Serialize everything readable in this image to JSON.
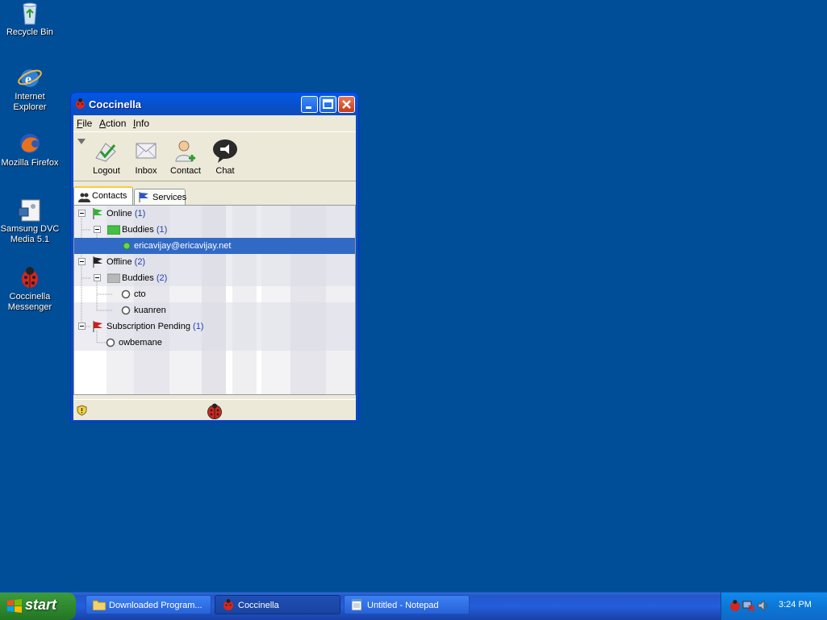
{
  "desktop": {
    "icons": [
      {
        "label": "Recycle Bin",
        "icon": "recycle-bin-icon"
      },
      {
        "label": "Internet Explorer",
        "icon": "internet-explorer-icon"
      },
      {
        "label": "Mozilla Firefox",
        "icon": "firefox-icon"
      },
      {
        "label": "Samsung DVC Media 5.1",
        "icon": "samsung-dvc-icon"
      },
      {
        "label": "Coccinella Messenger",
        "icon": "ladybug-icon"
      }
    ]
  },
  "window": {
    "title": "Coccinella",
    "menu": [
      "File",
      "Action",
      "Info"
    ],
    "toolbar": [
      {
        "label": "Logout",
        "icon": "logout-icon"
      },
      {
        "label": "Inbox",
        "icon": "inbox-icon"
      },
      {
        "label": "Contact",
        "icon": "add-contact-icon"
      },
      {
        "label": "Chat",
        "icon": "chat-icon"
      }
    ],
    "tabs": [
      {
        "label": "Contacts",
        "icon": "contacts-icon",
        "active": true
      },
      {
        "label": "Services",
        "icon": "flag-icon",
        "active": false
      }
    ],
    "tree": {
      "online": {
        "label": "Online",
        "count": "(1)"
      },
      "online_buddies": {
        "label": "Buddies",
        "count": "(1)"
      },
      "online_contact": "ericavijay@ericavijay.net",
      "offline": {
        "label": "Offline",
        "count": "(2)"
      },
      "offline_buddies": {
        "label": "Buddies",
        "count": "(2)"
      },
      "offline_contacts": [
        "cto",
        "kuanren"
      ],
      "pending": {
        "label": "Subscription Pending",
        "count": "(1)"
      },
      "pending_contact": "owbemane"
    }
  },
  "taskbar": {
    "start_label": "start",
    "tasks": [
      {
        "label": "Downloaded Program...",
        "icon": "folder-icon",
        "active": false
      },
      {
        "label": "Coccinella",
        "icon": "ladybug-icon",
        "active": true
      },
      {
        "label": "Untitled - Notepad",
        "icon": "notepad-icon",
        "active": false
      }
    ],
    "clock": "3:24 PM"
  },
  "colors": {
    "desktop": "#004e98",
    "selection": "#316ac5",
    "count_text": "#1f3fb0"
  }
}
